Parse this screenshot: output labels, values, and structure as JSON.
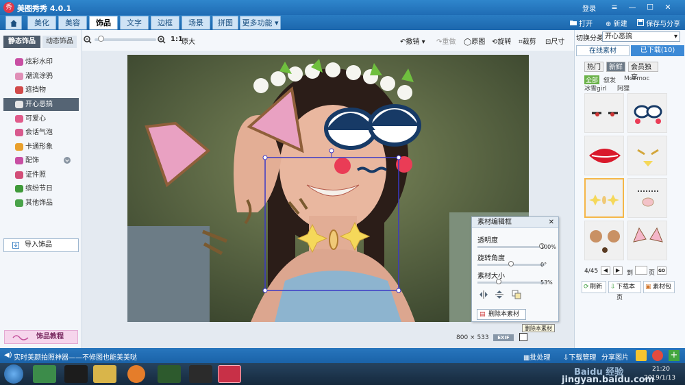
{
  "titlebar": {
    "app_logo": "秀",
    "title": "美图秀秀 4.0.1",
    "login": "登录",
    "menu_glyph": "≡",
    "min_glyph": "—",
    "max_glyph": "☐",
    "close_glyph": "✕"
  },
  "nav": {
    "tabs": [
      {
        "label": "美化"
      },
      {
        "label": "美容"
      },
      {
        "label": "饰品"
      },
      {
        "label": "文字"
      },
      {
        "label": "边框"
      },
      {
        "label": "场景"
      },
      {
        "label": "拼图"
      },
      {
        "label": "更多功能 ▾"
      }
    ],
    "active_tab": "饰品",
    "right_buttons": [
      {
        "label": "打开"
      },
      {
        "label": "新建"
      },
      {
        "label": "保存与分享"
      }
    ]
  },
  "left_panel": {
    "tabs": [
      {
        "label": "静态饰品"
      },
      {
        "label": "动态饰品"
      }
    ],
    "categories": [
      {
        "label": "炫彩水印",
        "color": "#c84fa3"
      },
      {
        "label": "潮流涂鸦",
        "color": "#e08fb7"
      },
      {
        "label": "遮挡物",
        "color": "#d14a4a"
      },
      {
        "label": "开心恶搞",
        "color": "#3b3b3b"
      },
      {
        "label": "可爱心",
        "color": "#e05b8a"
      },
      {
        "label": "会话气泡",
        "color": "#d85a8e"
      },
      {
        "label": "卡通形象",
        "color": "#e9a02c"
      },
      {
        "label": "配饰",
        "color": "#c84fa3"
      },
      {
        "label": "证件照",
        "color": "#d24e78"
      },
      {
        "label": "缤纷节日",
        "color": "#3f9a3a"
      },
      {
        "label": "其他饰品",
        "color": "#4aa34a"
      }
    ],
    "active_category": "开心恶搞",
    "import_label": "导入饰品",
    "tutorial_label": "饰品教程"
  },
  "toolbar": {
    "ratio": "1:1",
    "original_size": "原大",
    "undo": "撤销",
    "redo": "重做",
    "original": "原图",
    "rotate": "旋转",
    "crop": "裁剪",
    "size": "尺寸",
    "zoom_percent": 0.05
  },
  "right_panel": {
    "category_label": "切换分类",
    "category_value": "开心恶搞",
    "tabs": [
      {
        "label": "在线素材"
      },
      {
        "label": "已下载(10)"
      }
    ],
    "filters": [
      {
        "label": "热门"
      },
      {
        "label": "新鲜"
      },
      {
        "label": "会员独享"
      }
    ],
    "subfilters": [
      {
        "label": "全部"
      },
      {
        "label": "叙发"
      },
      {
        "label": "Mocmoc"
      },
      {
        "label": "冰雪girl"
      },
      {
        "label": "阿狸"
      }
    ],
    "page_info": "4/45",
    "page_to": "到",
    "page_unit": "页",
    "go_label": "GO",
    "refresh": "刷新",
    "download_page": "下载本页",
    "library": "素材包"
  },
  "editor": {
    "title": "素材编辑框",
    "opacity_label": "透明度",
    "opacity_value": "100%",
    "opacity_fraction": 1.0,
    "rotation_label": "旋转角度",
    "rotation_value": "0°",
    "rotation_fraction": 0.5,
    "size_label": "素材大小",
    "size_value": "53%",
    "size_fraction": 0.3,
    "delete_label": "删除本素材",
    "tooltip": "删除本素材"
  },
  "canvas": {
    "dimensions": "800 × 533",
    "exif": "EXIF"
  },
  "statusbar": {
    "message": "实时美颜拍照神器——不修图也能美美哒",
    "batch": "批处理",
    "download_mgr": "下载管理",
    "share": "分享图片"
  },
  "taskbar": {
    "time": "21:20",
    "date": "2019/1/13",
    "watermark": "Baidu 经验",
    "watermark_url": "jingyan.baidu.com"
  }
}
